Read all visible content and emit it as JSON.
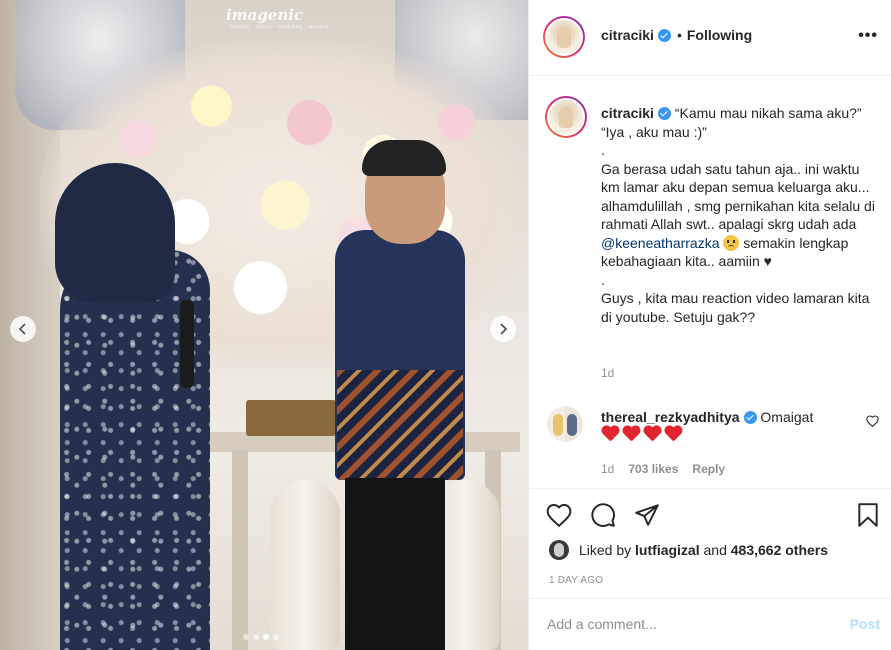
{
  "photo": {
    "watermark": "imagenic",
    "watermark_sub": "beauty · story · wedding · events",
    "carousel": {
      "count": 4,
      "active_index": 2
    }
  },
  "post": {
    "author": {
      "username": "citraciki",
      "verified": true,
      "follow_status": "Following"
    },
    "caption": {
      "username": "citraciki",
      "lines": [
        "“Kamu mau nikah sama aku?” “Iya , aku mau :)”",
        ".",
        "Ga berasa udah satu tahun aja.. ini waktu km lamar aku depan semua keluarga aku... alhamdulillah , smg pernikahan kita selalu di rahmati Allah swt.. apalagi skrg udah ada",
        "semakin lengkap kebahagiaan kita.. aamiin ♥",
        ".",
        "Guys , kita mau reaction video lamaran kita di youtube. Setuju gak??"
      ],
      "mention": "@keeneatharrazka",
      "time": "1d"
    },
    "comments": [
      {
        "username": "thereal_rezkyadhitya",
        "verified": true,
        "text": "Omaigat",
        "hearts": 4,
        "time": "1d",
        "likes": "703 likes",
        "reply": "Reply"
      }
    ],
    "likes": {
      "prefix": "Liked by",
      "user": "lutfiagizal",
      "suffix": "and",
      "others": "483,662 others"
    },
    "date": "1 DAY AGO",
    "add_comment_placeholder": "Add a comment...",
    "post_label": "Post"
  },
  "icons": {
    "heart": "heart-icon",
    "comment": "comment-icon",
    "share": "paper-plane-icon",
    "bookmark": "bookmark-icon",
    "more": "more-options-icon",
    "verified": "verified-badge-icon"
  },
  "colors": {
    "verified": "#3897f0",
    "heart_red": "#e0252e",
    "mention": "#00376b",
    "muted": "#8e8e8e",
    "post_disabled": "#b2dffc"
  }
}
